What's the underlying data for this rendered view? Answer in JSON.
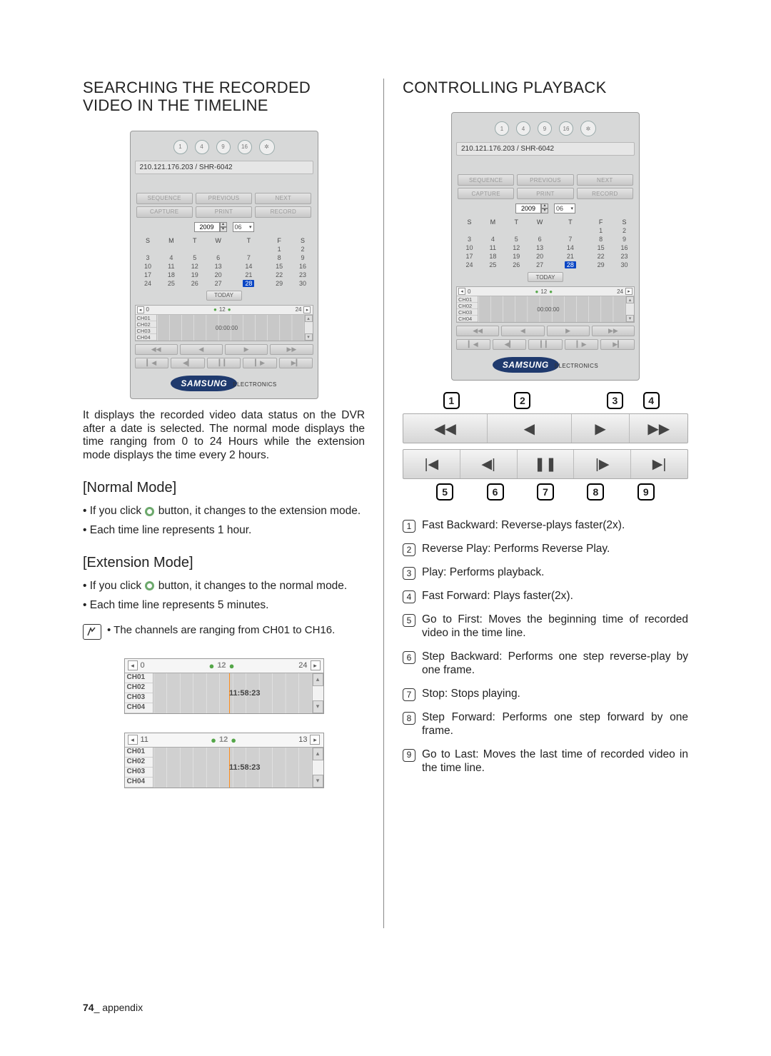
{
  "left": {
    "heading": "SEARCHING THE RECORDED VIDEO IN THE TIMELINE",
    "panel": {
      "circles": [
        "1",
        "4",
        "9",
        "16",
        "wheel"
      ],
      "titlebar": "210.121.176.203 / SHR-6042",
      "btns1": [
        "SEQUENCE",
        "PREVIOUS",
        "NEXT"
      ],
      "btns2": [
        "CAPTURE",
        "PRINT",
        "RECORD"
      ],
      "year": "2009",
      "month": "06",
      "dow": [
        "S",
        "M",
        "T",
        "W",
        "T",
        "F",
        "S"
      ],
      "calendar": [
        [
          "",
          "",
          "",
          "",
          "",
          "1",
          "2"
        ],
        [
          "3",
          "4",
          "5",
          "6",
          "7",
          "8",
          "9"
        ],
        [
          "10",
          "11",
          "12",
          "13",
          "14",
          "15",
          "16"
        ],
        [
          "17",
          "18",
          "19",
          "20",
          "21",
          "22",
          "23"
        ],
        [
          "24",
          "25",
          "26",
          "27",
          "28",
          "29",
          "30"
        ]
      ],
      "selected_day": "28",
      "today": "TODAY",
      "tl_left": "0",
      "tl_mid": "12",
      "tl_right": "24",
      "channels": [
        "CH01",
        "CH02",
        "CH03",
        "CH04"
      ],
      "tl_time": "00:00:00",
      "play1": [
        "◀◀",
        "◀",
        "▶",
        "▶▶"
      ],
      "play2": [
        "▎◀",
        "◀▎",
        "▎▎",
        "▎▶",
        "▶▎"
      ],
      "brand": "SAMSUNG",
      "brand_sub": "ELECTRONICS"
    },
    "para": "It displays the recorded video data status on the DVR after a date is selected. The normal mode displays the time ranging from 0 to 24 Hours while the extension mode displays the time every 2 hours.",
    "normal_h": "[Normal Mode]",
    "normal_b": [
      "If you click  button, it changes to the extension mode.",
      "Each time line represents 1 hour."
    ],
    "ext_h": "[Extension Mode]",
    "ext_b": [
      "If you click  button, it changes to the normal mode.",
      "Each time line represents 5 minutes."
    ],
    "note": "The channels are ranging from CH01 to CH16.",
    "tl1": {
      "left": "0",
      "mid": "12",
      "right": "24",
      "channels": [
        "CH01",
        "CH02",
        "CH03",
        "CH04"
      ],
      "time": "11:58:23"
    },
    "tl2": {
      "left": "11",
      "mid": "12",
      "right": "13",
      "channels": [
        "CH01",
        "CH02",
        "CH03",
        "CH04"
      ],
      "time": "11:58:23"
    }
  },
  "right": {
    "heading": "CONTROLLING PLAYBACK",
    "panel": {
      "circles": [
        "1",
        "4",
        "9",
        "16",
        "wheel"
      ],
      "titlebar": "210.121.176.203 / SHR-6042",
      "btns1": [
        "SEQUENCE",
        "PREVIOUS",
        "NEXT"
      ],
      "btns2": [
        "CAPTURE",
        "PRINT",
        "RECORD"
      ],
      "year": "2009",
      "month": "06",
      "dow": [
        "S",
        "M",
        "T",
        "W",
        "T",
        "F",
        "S"
      ],
      "calendar": [
        [
          "",
          "",
          "",
          "",
          "",
          "1",
          "2"
        ],
        [
          "3",
          "4",
          "5",
          "6",
          "7",
          "8",
          "9"
        ],
        [
          "10",
          "11",
          "12",
          "13",
          "14",
          "15",
          "16"
        ],
        [
          "17",
          "18",
          "19",
          "20",
          "21",
          "22",
          "23"
        ],
        [
          "24",
          "25",
          "26",
          "27",
          "28",
          "29",
          "30"
        ]
      ],
      "selected_day": "28",
      "today": "TODAY",
      "tl_left": "0",
      "tl_mid": "12",
      "tl_right": "24",
      "channels": [
        "CH01",
        "CH02",
        "CH03",
        "CH04"
      ],
      "tl_time": "00:00:00",
      "play1": [
        "◀◀",
        "◀",
        "▶",
        "▶▶"
      ],
      "play2": [
        "▎◀",
        "◀▎",
        "▎▎",
        "▎▶",
        "▶▎"
      ],
      "brand": "SAMSUNG",
      "brand_sub": "ELECTRONICS"
    },
    "diagram": {
      "top_nums": [
        "1",
        "2",
        "3",
        "4"
      ],
      "top_icons": [
        "◀◀",
        "◀",
        "▶",
        "▶▶"
      ],
      "bot_icons": [
        "|◀",
        "◀|",
        "❚❚",
        "|▶",
        "▶|"
      ],
      "bot_nums": [
        "5",
        "6",
        "7",
        "8",
        "9"
      ]
    },
    "list": [
      "Fast Backward: Reverse-plays faster(2x).",
      "Reverse Play: Performs Reverse Play.",
      "Play: Performs playback.",
      "Fast Forward: Plays faster(2x).",
      "Go to First: Moves the beginning time of recorded video in the time line.",
      "Step Backward: Performs one step reverse-play by one frame.",
      "Stop: Stops playing.",
      "Step Forward: Performs one step forward by one frame.",
      "Go to Last: Moves the last time of recorded video in the time line."
    ]
  },
  "footer": {
    "page": "74",
    "label": "_ appendix"
  }
}
